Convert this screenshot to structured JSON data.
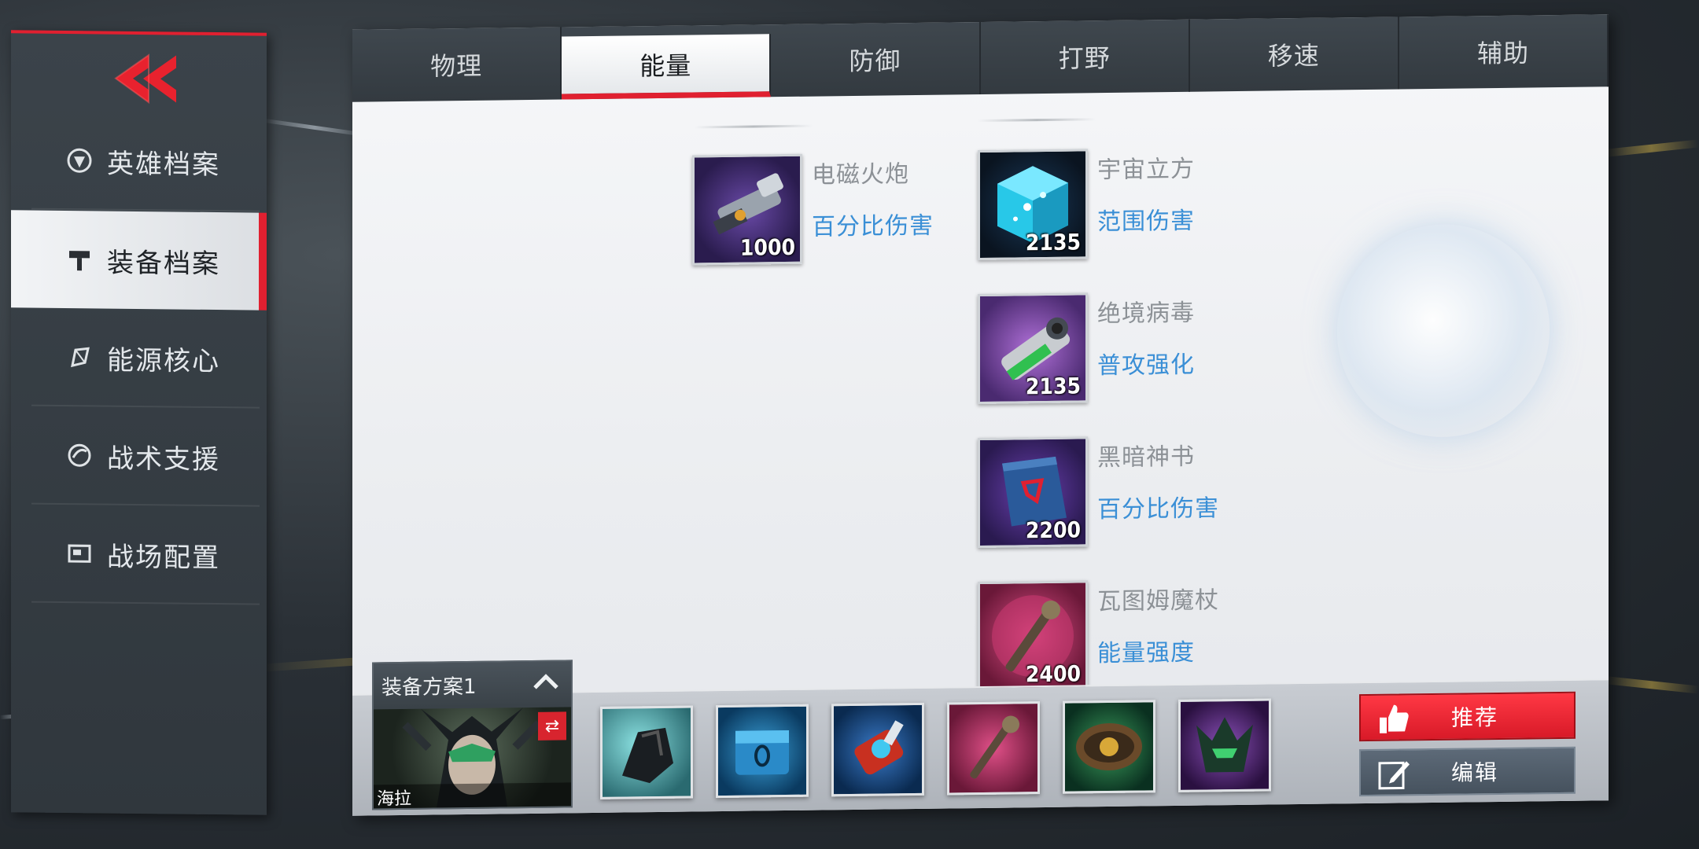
{
  "sidebar": {
    "items": [
      {
        "label": "英雄档案",
        "icon": "hero-emblem-icon"
      },
      {
        "label": "装备档案",
        "icon": "hammer-icon"
      },
      {
        "label": "能源核心",
        "icon": "crystal-icon"
      },
      {
        "label": "战术支援",
        "icon": "tactical-swirl-icon"
      },
      {
        "label": "战场配置",
        "icon": "config-card-icon"
      }
    ]
  },
  "tabs": [
    "物理",
    "能量",
    "防御",
    "打野",
    "移速",
    "辅助"
  ],
  "items": [
    {
      "name": "电磁火炮",
      "tag": "百分比伤害",
      "cost": "1000",
      "icon": "railgun-icon"
    },
    {
      "name": "宇宙立方",
      "tag": "范围伤害",
      "cost": "2135",
      "icon": "cosmic-cube-icon"
    },
    {
      "name": "绝境病毒",
      "tag": "普攻强化",
      "cost": "2135",
      "icon": "virus-cannon-icon"
    },
    {
      "name": "黑暗神书",
      "tag": "百分比伤害",
      "cost": "2200",
      "icon": "dark-tome-icon"
    },
    {
      "name": "瓦图姆魔杖",
      "tag": "能量强度",
      "cost": "2400",
      "icon": "watoomb-wand-icon"
    }
  ],
  "loadout": {
    "title": "装备方案1",
    "hero_name": "海拉",
    "slots": [
      "dark-gauntlet-icon",
      "blue-chest-icon",
      "energy-cannon-icon",
      "magic-wand-icon",
      "green-belt-icon",
      "dark-helm-icon"
    ]
  },
  "actions": {
    "recommend": "推荐",
    "edit": "编辑"
  },
  "colors": {
    "accent_red": "#e02030",
    "tag_blue": "#3a8fd6"
  }
}
